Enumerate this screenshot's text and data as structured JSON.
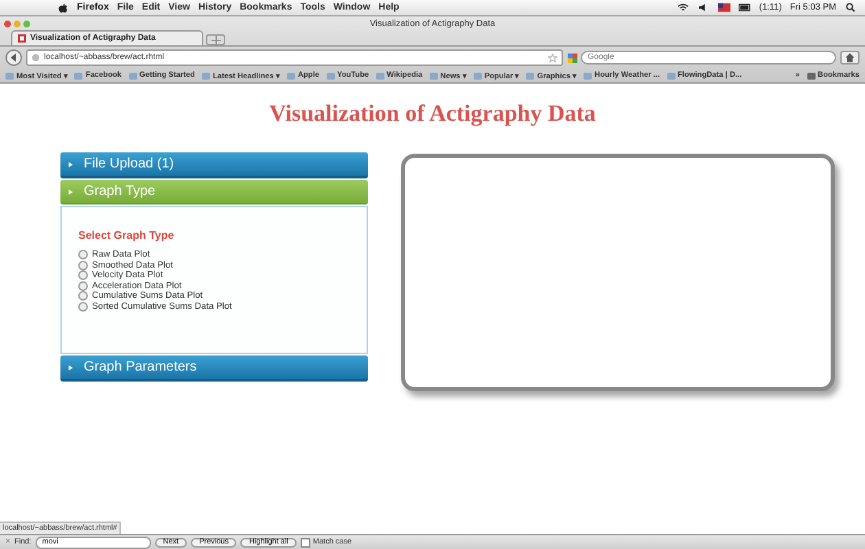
{
  "menubar": {
    "app": "Firefox",
    "menus": [
      "File",
      "Edit",
      "View",
      "History",
      "Bookmarks",
      "Tools",
      "Window",
      "Help"
    ],
    "battery": "(1:11)",
    "clock": "Fri 5:03 PM"
  },
  "window": {
    "title": "Visualization of Actigraphy Data"
  },
  "tabs": [
    {
      "title": "Visualization of Actigraphy Data",
      "selected": true
    }
  ],
  "address_bar": {
    "url": "localhost/~abbass/brew/act.rhtml"
  },
  "search": {
    "placeholder": "Google"
  },
  "bookmarks": [
    {
      "label": "Most Visited ▾"
    },
    {
      "label": "Facebook"
    },
    {
      "label": "Getting Started"
    },
    {
      "label": "Latest Headlines ▾"
    },
    {
      "label": "Apple"
    },
    {
      "label": "YouTube"
    },
    {
      "label": "Wikipedia"
    },
    {
      "label": "News ▾"
    },
    {
      "label": "Popular ▾"
    },
    {
      "label": "Graphics ▾"
    },
    {
      "label": "Hourly Weather ..."
    },
    {
      "label": "FlowingData | D..."
    }
  ],
  "bookmarks_more": "»",
  "bookmarks_menu": "Bookmarks",
  "page": {
    "heading": "Visualization of Actigraphy Data",
    "sections": [
      {
        "title": "File Upload (1)",
        "expanded": false
      },
      {
        "title": "Graph Type",
        "expanded": true,
        "subheading": "Select Graph Type",
        "options": [
          {
            "label": "Raw Data Plot",
            "selected": false
          },
          {
            "label": "Smoothed Data Plot",
            "selected": false
          },
          {
            "label": "Velocity Data Plot",
            "selected": false
          },
          {
            "label": "Acceleration Data Plot",
            "selected": false
          },
          {
            "label": "Cumulative Sums Data Plot",
            "selected": false
          },
          {
            "label": "Sorted Cumulative Sums Data Plot",
            "selected": false
          }
        ]
      },
      {
        "title": "Graph Parameters",
        "expanded": false
      }
    ]
  },
  "status_url": "localhost/~abbass/brew/act.rhtml#",
  "find_bar": {
    "close": "×",
    "label": "Find:",
    "value": "movi",
    "buttons": [
      "Next",
      "Previous"
    ],
    "highlight": "Highlight all",
    "match_case": {
      "label": "Match case",
      "checked": false
    }
  }
}
